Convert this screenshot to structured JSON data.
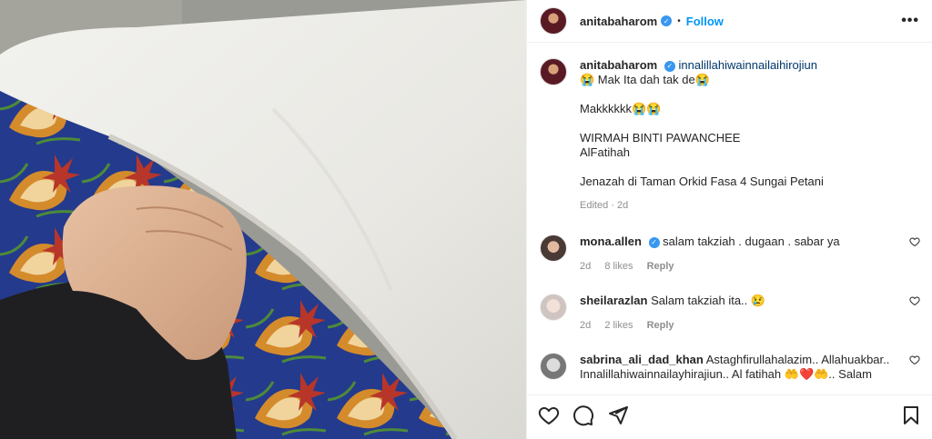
{
  "post": {
    "username": "anitabaharom",
    "follow_label": "Follow",
    "separator": "•",
    "more_label": "•••"
  },
  "caption": {
    "username": "anitabaharom",
    "tag": "innalillahiwainnailaihirojiun",
    "line1": "😭 Mak Ita dah tak de😭",
    "line2": "Makkkkkk😭😭",
    "line3": "WIRMAH BINTI PAWANCHEE",
    "line4": "AlFatihah",
    "line5": "Jenazah di Taman Orkid Fasa 4 Sungai Petani",
    "meta": "Edited · 2d"
  },
  "comments": [
    {
      "username": "mona.allen",
      "verified": true,
      "text": "salam takziah . dugaan . sabar ya",
      "age": "2d",
      "likes": "8 likes",
      "reply": "Reply"
    },
    {
      "username": "sheilarazlan",
      "verified": false,
      "text": "Salam takziah ita.. 😢",
      "age": "2d",
      "likes": "2 likes",
      "reply": "Reply"
    },
    {
      "username": "sabrina_ali_dad_khan",
      "verified": false,
      "text": "Astaghfirullahalazim.. Allahuakbar.. Innalillahiwainnailayhirajiun.. Al fatihah 🤲❤️🤲.. Salam",
      "age": "",
      "likes": "",
      "reply": ""
    }
  ],
  "icons": {
    "like": "heart-icon",
    "comment": "comment-icon",
    "share": "share-icon",
    "save": "bookmark-icon"
  },
  "colors": {
    "accent": "#0095f6",
    "verified": "#3897f0",
    "muted": "#8e8e8e"
  }
}
